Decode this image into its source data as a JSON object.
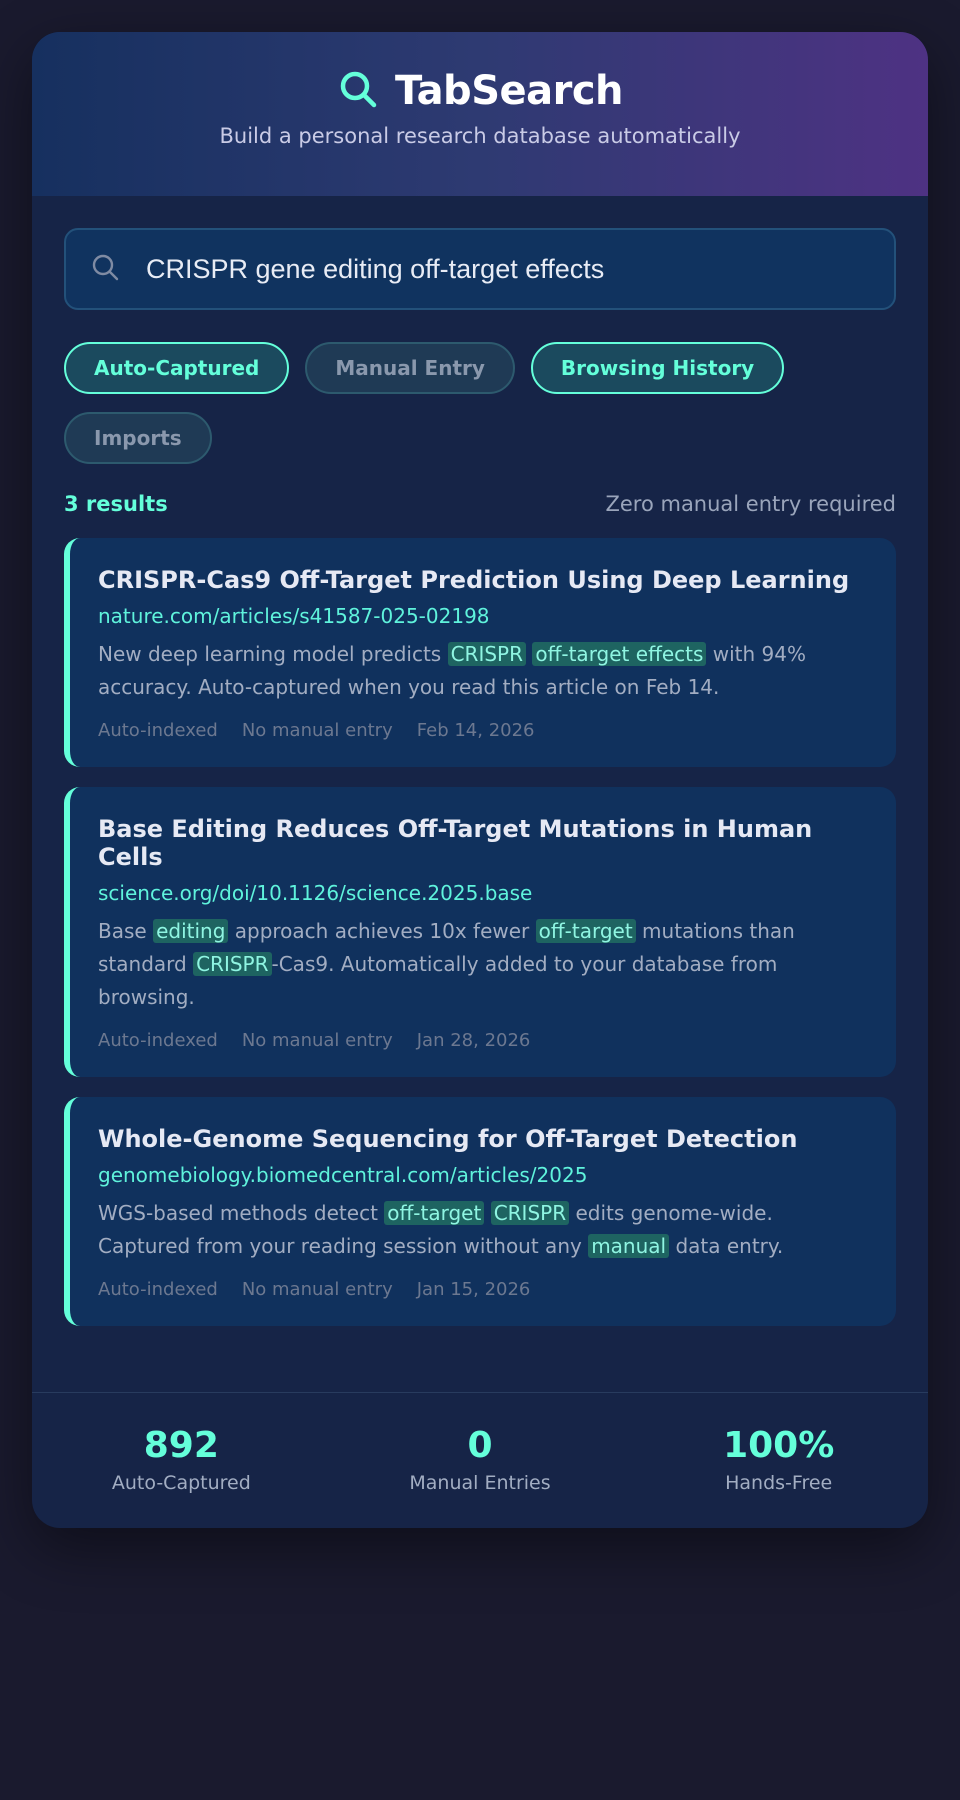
{
  "header": {
    "title": "TabSearch",
    "subtitle": "Build a personal research database automatically",
    "icon": "search-icon"
  },
  "search": {
    "value": "CRISPR gene editing off-target effects",
    "icon": "search-icon"
  },
  "filters": [
    {
      "label": "Auto-Captured",
      "active": true
    },
    {
      "label": "Manual Entry",
      "active": false
    },
    {
      "label": "Browsing History",
      "active": true
    },
    {
      "label": "Imports",
      "active": false
    }
  ],
  "results_meta": {
    "count": "3 results",
    "note": "Zero manual entry required"
  },
  "results": [
    {
      "title": "CRISPR-Cas9 Off-Target Prediction Using Deep Learning",
      "url": "nature.com/articles/s41587-025-02198",
      "snippet_parts": [
        {
          "t": "New deep learning model predicts ",
          "hl": false
        },
        {
          "t": "CRISPR",
          "hl": true
        },
        {
          "t": " ",
          "hl": false
        },
        {
          "t": "off-target effects",
          "hl": true
        },
        {
          "t": " with 94% accuracy. Auto-captured when you read this article on Feb 14.",
          "hl": false
        }
      ],
      "tag1": "Auto-indexed",
      "tag2": "No manual entry",
      "date": "Feb 14, 2026"
    },
    {
      "title": "Base Editing Reduces Off-Target Mutations in Human Cells",
      "url": "science.org/doi/10.1126/science.2025.base",
      "snippet_parts": [
        {
          "t": "Base ",
          "hl": false
        },
        {
          "t": "editing",
          "hl": true
        },
        {
          "t": " approach achieves 10x fewer ",
          "hl": false
        },
        {
          "t": "off-target",
          "hl": true
        },
        {
          "t": " mutations than standard ",
          "hl": false
        },
        {
          "t": "CRISPR",
          "hl": true
        },
        {
          "t": "-Cas9. Automatically added to your database from browsing.",
          "hl": false
        }
      ],
      "tag1": "Auto-indexed",
      "tag2": "No manual entry",
      "date": "Jan 28, 2026"
    },
    {
      "title": "Whole-Genome Sequencing for Off-Target Detection",
      "url": "genomebiology.biomedcentral.com/articles/2025",
      "snippet_parts": [
        {
          "t": "WGS-based methods detect ",
          "hl": false
        },
        {
          "t": "off-target",
          "hl": true
        },
        {
          "t": " ",
          "hl": false
        },
        {
          "t": "CRISPR",
          "hl": true
        },
        {
          "t": " edits genome-wide. Captured from your reading session without any ",
          "hl": false
        },
        {
          "t": "manual",
          "hl": true
        },
        {
          "t": " data entry.",
          "hl": false
        }
      ],
      "tag1": "Auto-indexed",
      "tag2": "No manual entry",
      "date": "Jan 15, 2026"
    }
  ],
  "stats": [
    {
      "value": "892",
      "label": "Auto-Captured"
    },
    {
      "value": "0",
      "label": "Manual Entries"
    },
    {
      "value": "100%",
      "label": "Hands-Free"
    }
  ],
  "colors": {
    "accent": "#64ffda",
    "background": "#1a1a2e",
    "card": "#162447"
  }
}
